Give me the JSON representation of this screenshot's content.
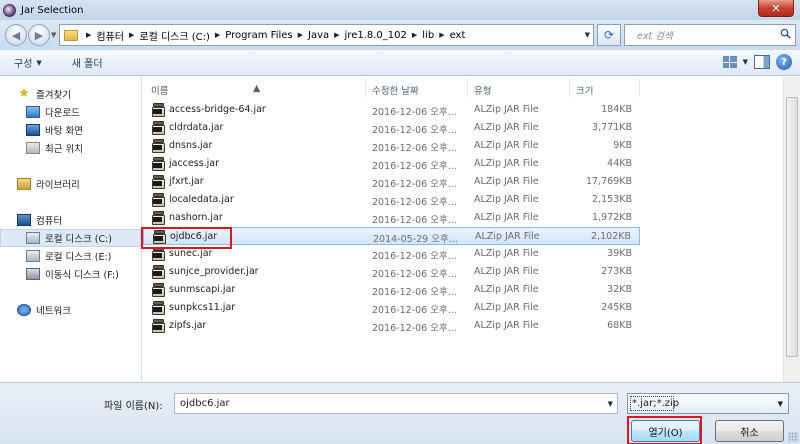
{
  "window": {
    "title": "Jar Selection",
    "close_glyph": "✕"
  },
  "address": {
    "crumbs": [
      "컴퓨터",
      "로컬 디스크 (C:)",
      "Program Files",
      "Java",
      "jre1.8.0_102",
      "lib",
      "ext"
    ],
    "search_placeholder": "ext 검색"
  },
  "toolbar": {
    "organize": "구성",
    "new_folder": "새 폴더"
  },
  "nav": {
    "favorites": "즐겨찾기",
    "downloads": "다운로드",
    "desktop": "바탕 화면",
    "recent": "최근 위치",
    "libraries": "라이브러리",
    "computer": "컴퓨터",
    "drive_c": "로컬 디스크 (C:)",
    "drive_e": "로컬 디스크 (E:)",
    "drive_f": "이동식 디스크 (F:)",
    "network": "네트워크"
  },
  "columns": {
    "name": "이름",
    "modified": "수정한 날짜",
    "type": "유형",
    "size": "크기"
  },
  "files": [
    {
      "name": "access-bridge-64.jar",
      "modified": "2016-12-06 오후...",
      "type": "ALZip JAR File",
      "size": "184KB"
    },
    {
      "name": "cldrdata.jar",
      "modified": "2016-12-06 오후...",
      "type": "ALZip JAR File",
      "size": "3,771KB"
    },
    {
      "name": "dnsns.jar",
      "modified": "2016-12-06 오후...",
      "type": "ALZip JAR File",
      "size": "9KB"
    },
    {
      "name": "jaccess.jar",
      "modified": "2016-12-06 오후...",
      "type": "ALZip JAR File",
      "size": "44KB"
    },
    {
      "name": "jfxrt.jar",
      "modified": "2016-12-06 오후...",
      "type": "ALZip JAR File",
      "size": "17,769KB"
    },
    {
      "name": "localedata.jar",
      "modified": "2016-12-06 오후...",
      "type": "ALZip JAR File",
      "size": "2,153KB"
    },
    {
      "name": "nashorn.jar",
      "modified": "2016-12-06 오후...",
      "type": "ALZip JAR File",
      "size": "1,972KB"
    },
    {
      "name": "ojdbc6.jar",
      "modified": "2014-05-29 오후...",
      "type": "ALZip JAR File",
      "size": "2,102KB"
    },
    {
      "name": "sunec.jar",
      "modified": "2016-12-06 오후...",
      "type": "ALZip JAR File",
      "size": "39KB"
    },
    {
      "name": "sunjce_provider.jar",
      "modified": "2016-12-06 오후...",
      "type": "ALZip JAR File",
      "size": "273KB"
    },
    {
      "name": "sunmscapi.jar",
      "modified": "2016-12-06 오후...",
      "type": "ALZip JAR File",
      "size": "32KB"
    },
    {
      "name": "sunpkcs11.jar",
      "modified": "2016-12-06 오후...",
      "type": "ALZip JAR File",
      "size": "245KB"
    },
    {
      "name": "zipfs.jar",
      "modified": "2016-12-06 오후...",
      "type": "ALZip JAR File",
      "size": "68KB"
    }
  ],
  "selected_file": "ojdbc6.jar",
  "footer": {
    "filename_label": "파일 이름(N):",
    "filename_value": "ojdbc6.jar",
    "filetype_value": "*.jar;*.zip",
    "open_button": "열기(O)",
    "cancel_button": "취소"
  },
  "colors": {
    "highlight": "#e0161a",
    "selection": "#d2e5fa"
  }
}
